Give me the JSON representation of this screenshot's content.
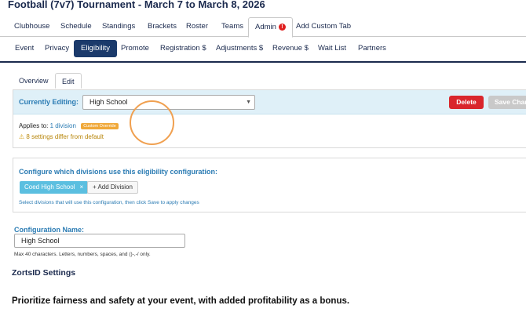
{
  "header": {
    "title": "Football (7v7) Tournament  -  March 7 to March 8, 2026"
  },
  "main_tabs": [
    {
      "label": "Clubhouse"
    },
    {
      "label": "Schedule"
    },
    {
      "label": "Standings"
    },
    {
      "label": "Brackets"
    },
    {
      "label": "Roster"
    },
    {
      "label": "Teams"
    },
    {
      "label": "Admin",
      "alert": "!"
    },
    {
      "label": "Add Custom Tab"
    }
  ],
  "admin_tabs": [
    {
      "label": "Event"
    },
    {
      "label": "Privacy"
    },
    {
      "label": "Eligibility"
    },
    {
      "label": "Promote"
    },
    {
      "label": "Registration $"
    },
    {
      "label": "Adjustments $"
    },
    {
      "label": "Revenue $"
    },
    {
      "label": "Wait List"
    },
    {
      "label": "Partners"
    }
  ],
  "sub_tabs": [
    {
      "label": "Overview"
    },
    {
      "label": "Edit"
    }
  ],
  "editing": {
    "label": "Currently Editing:",
    "selected": "High School",
    "delete_label": "Delete",
    "save_label": "Save Changes",
    "applies_prefix": "Applies to:",
    "applies_link": "1 division",
    "badge": "Custom Override",
    "warning": "8 settings differ from default"
  },
  "divisions": {
    "title": "Configure which divisions use this eligibility configuration:",
    "chip": "Coed High School",
    "chip_close": "×",
    "add_label": "+ Add Division",
    "hint": "Select divisions that will use this configuration, then click Save to apply changes"
  },
  "config_name": {
    "label": "Configuration Name:",
    "value": "High School",
    "hint": "Max 40 characters. Letters, numbers, spaces, and ()-,-/ only."
  },
  "zortsid": {
    "title": "ZortsID Settings"
  },
  "footer": {
    "text": "Prioritize fairness and safety at your event, with added profitability as a bonus."
  },
  "icons": {
    "alert": "alert-icon",
    "warning": "warning-icon",
    "chevron": "chevron-down-icon",
    "close": "close-icon"
  },
  "colors": {
    "navy": "#1b3a6b",
    "accent_blue": "#2a7bb3",
    "delete_red": "#d9262c",
    "chip_blue": "#5bbfe0",
    "badge_orange": "#f0a838",
    "cursor_ring": "#f0a050"
  }
}
